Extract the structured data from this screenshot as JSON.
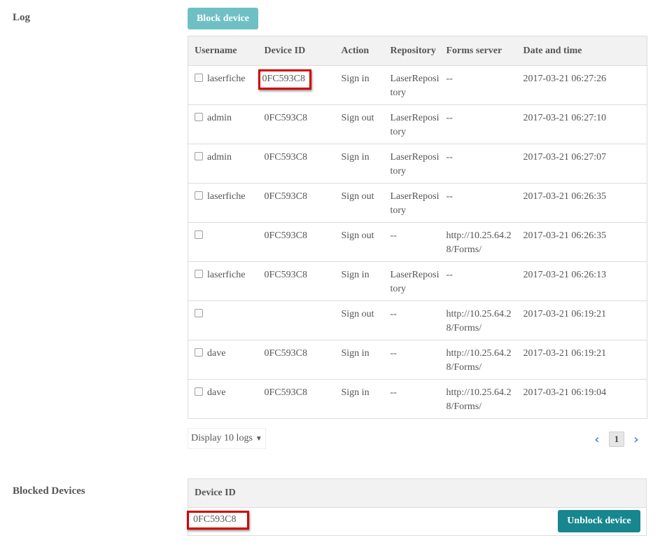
{
  "log_section": {
    "label": "Log",
    "block_button": "Block device",
    "columns": [
      "Username",
      "Device ID",
      "Action",
      "Repository",
      "Forms server",
      "Date and time"
    ],
    "rows": [
      {
        "username": "laserfiche",
        "device_id": "0FC593C8",
        "action": "Sign in",
        "repository": "LaserRepository",
        "forms_server": "--",
        "datetime": "2017-03-21 06:27:26",
        "highlighted": true
      },
      {
        "username": "admin",
        "device_id": "0FC593C8",
        "action": "Sign out",
        "repository": "LaserRepository",
        "forms_server": "--",
        "datetime": "2017-03-21 06:27:10",
        "highlighted": false
      },
      {
        "username": "admin",
        "device_id": "0FC593C8",
        "action": "Sign in",
        "repository": "LaserRepository",
        "forms_server": "--",
        "datetime": "2017-03-21 06:27:07",
        "highlighted": false
      },
      {
        "username": "laserfiche",
        "device_id": "0FC593C8",
        "action": "Sign out",
        "repository": "LaserRepository",
        "forms_server": "--",
        "datetime": "2017-03-21 06:26:35",
        "highlighted": false
      },
      {
        "username": "",
        "device_id": "0FC593C8",
        "action": "Sign out",
        "repository": "--",
        "forms_server": "http://10.25.64.28/Forms/",
        "datetime": "2017-03-21 06:26:35",
        "highlighted": false
      },
      {
        "username": "laserfiche",
        "device_id": "0FC593C8",
        "action": "Sign in",
        "repository": "LaserRepository",
        "forms_server": "--",
        "datetime": "2017-03-21 06:26:13",
        "highlighted": false
      },
      {
        "username": "",
        "device_id": "",
        "action": "Sign out",
        "repository": "--",
        "forms_server": "http://10.25.64.28/Forms/",
        "datetime": "2017-03-21 06:19:21",
        "highlighted": false
      },
      {
        "username": "dave",
        "device_id": "0FC593C8",
        "action": "Sign in",
        "repository": "--",
        "forms_server": "http://10.25.64.28/Forms/",
        "datetime": "2017-03-21 06:19:21",
        "highlighted": false
      },
      {
        "username": "dave",
        "device_id": "0FC593C8",
        "action": "Sign in",
        "repository": "--",
        "forms_server": "http://10.25.64.28/Forms/",
        "datetime": "2017-03-21 06:19:04",
        "highlighted": false
      }
    ],
    "display_select": "Display 10 logs",
    "current_page": "1"
  },
  "blocked_section": {
    "label": "Blocked Devices",
    "column": "Device ID",
    "device_id": "0FC593C8",
    "unblock_button": "Unblock device"
  },
  "colors": {
    "block_button": "#6fc0c4",
    "unblock_button": "#17868e",
    "highlight": "#d40000"
  }
}
